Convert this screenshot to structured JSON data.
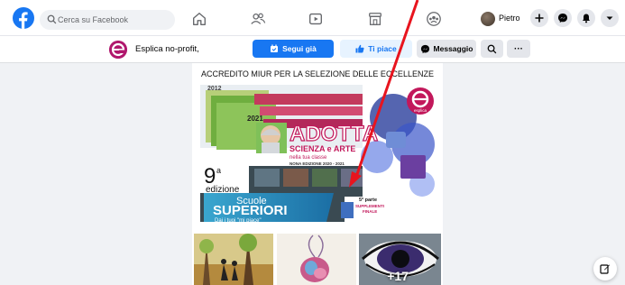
{
  "nav": {
    "search_placeholder": "Cerca su Facebook",
    "profile_name": "Pietro",
    "icons": [
      "home-icon",
      "friends-icon",
      "watch-icon",
      "marketplace-icon",
      "groups-icon"
    ]
  },
  "page": {
    "name": "Esplica no-profit,",
    "follow_label": "Segui già",
    "like_label": "Ti piace",
    "message_label": "Messaggio",
    "more_label": "···"
  },
  "post": {
    "caption": "ACCREDITO MIUR PER LA SELEZIONE DELLE ECCELLENZE",
    "poster": {
      "year_start": "2012",
      "year_end": "2021",
      "title": "ADOTTA",
      "subtitle": "SCIENZA e ARTE",
      "subtitle2": "nella tua classe",
      "edition_line": "NONA EDIZIONE   2020 - 2021",
      "edition_number": "9",
      "edition_sup": "a",
      "edition_word": "edizione",
      "banner_line1": "Scuole",
      "banner_line2": "SUPERIORI",
      "banner_line3": "Dai i tuoi \"mi piace\"",
      "sticker_line1": "5ª parte",
      "sticker_line2": "SUPPLEMENTI",
      "sticker_line3": "FINALE",
      "logo_text": "esplica"
    },
    "more_photos": "+17"
  },
  "colors": {
    "fb_blue": "#1877f2",
    "brand_magenta": "#c2185b",
    "annotation_red": "#e8141e"
  }
}
